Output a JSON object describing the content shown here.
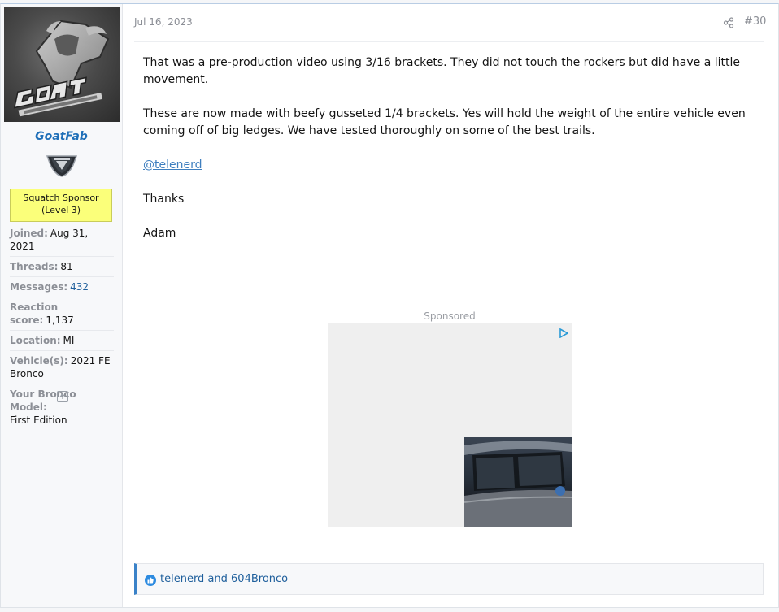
{
  "user": {
    "name": "GoatFab",
    "badge_line1": "Squatch Sponsor",
    "badge_line2": "(Level 3)",
    "stats": [
      {
        "label": "Joined:",
        "value": "Aug 31, 2021"
      },
      {
        "label": "Threads:",
        "value": "81"
      },
      {
        "label": "Messages:",
        "value": "432"
      },
      {
        "label": "Reaction score:",
        "value": "1,137"
      },
      {
        "label": "Location:",
        "value": "MI"
      },
      {
        "label": "Vehicle(s):",
        "value": "2021 FE Bronco"
      },
      {
        "label": "Your Bronco Model:",
        "value": "First Edition"
      }
    ],
    "avatar_icon": "goat-fabrication-logo",
    "rank_icon": "bronco-shield-icon"
  },
  "post": {
    "date": "Jul 16, 2023",
    "number": "#30",
    "paragraphs": [
      "That was a pre-production video using 3/16 brackets. They did not touch the rockers but did have a little movement.",
      "These are now made with beefy gusseted 1/4 brackets. Yes will hold the weight of the entire vehicle even coming off of big ledges. We have tested thoroughly on some of the best trails."
    ],
    "mention": "@telenerd",
    "thanks": "Thanks",
    "signature": "Adam"
  },
  "ad": {
    "label": "Sponsored"
  },
  "reactions": {
    "text": "telenerd and 604Bronco",
    "icon": "like-icon"
  },
  "colors": {
    "accent": "#1f6fb8",
    "badge_bg": "#fbff7a",
    "reaction_bar": "#3a82c8"
  }
}
